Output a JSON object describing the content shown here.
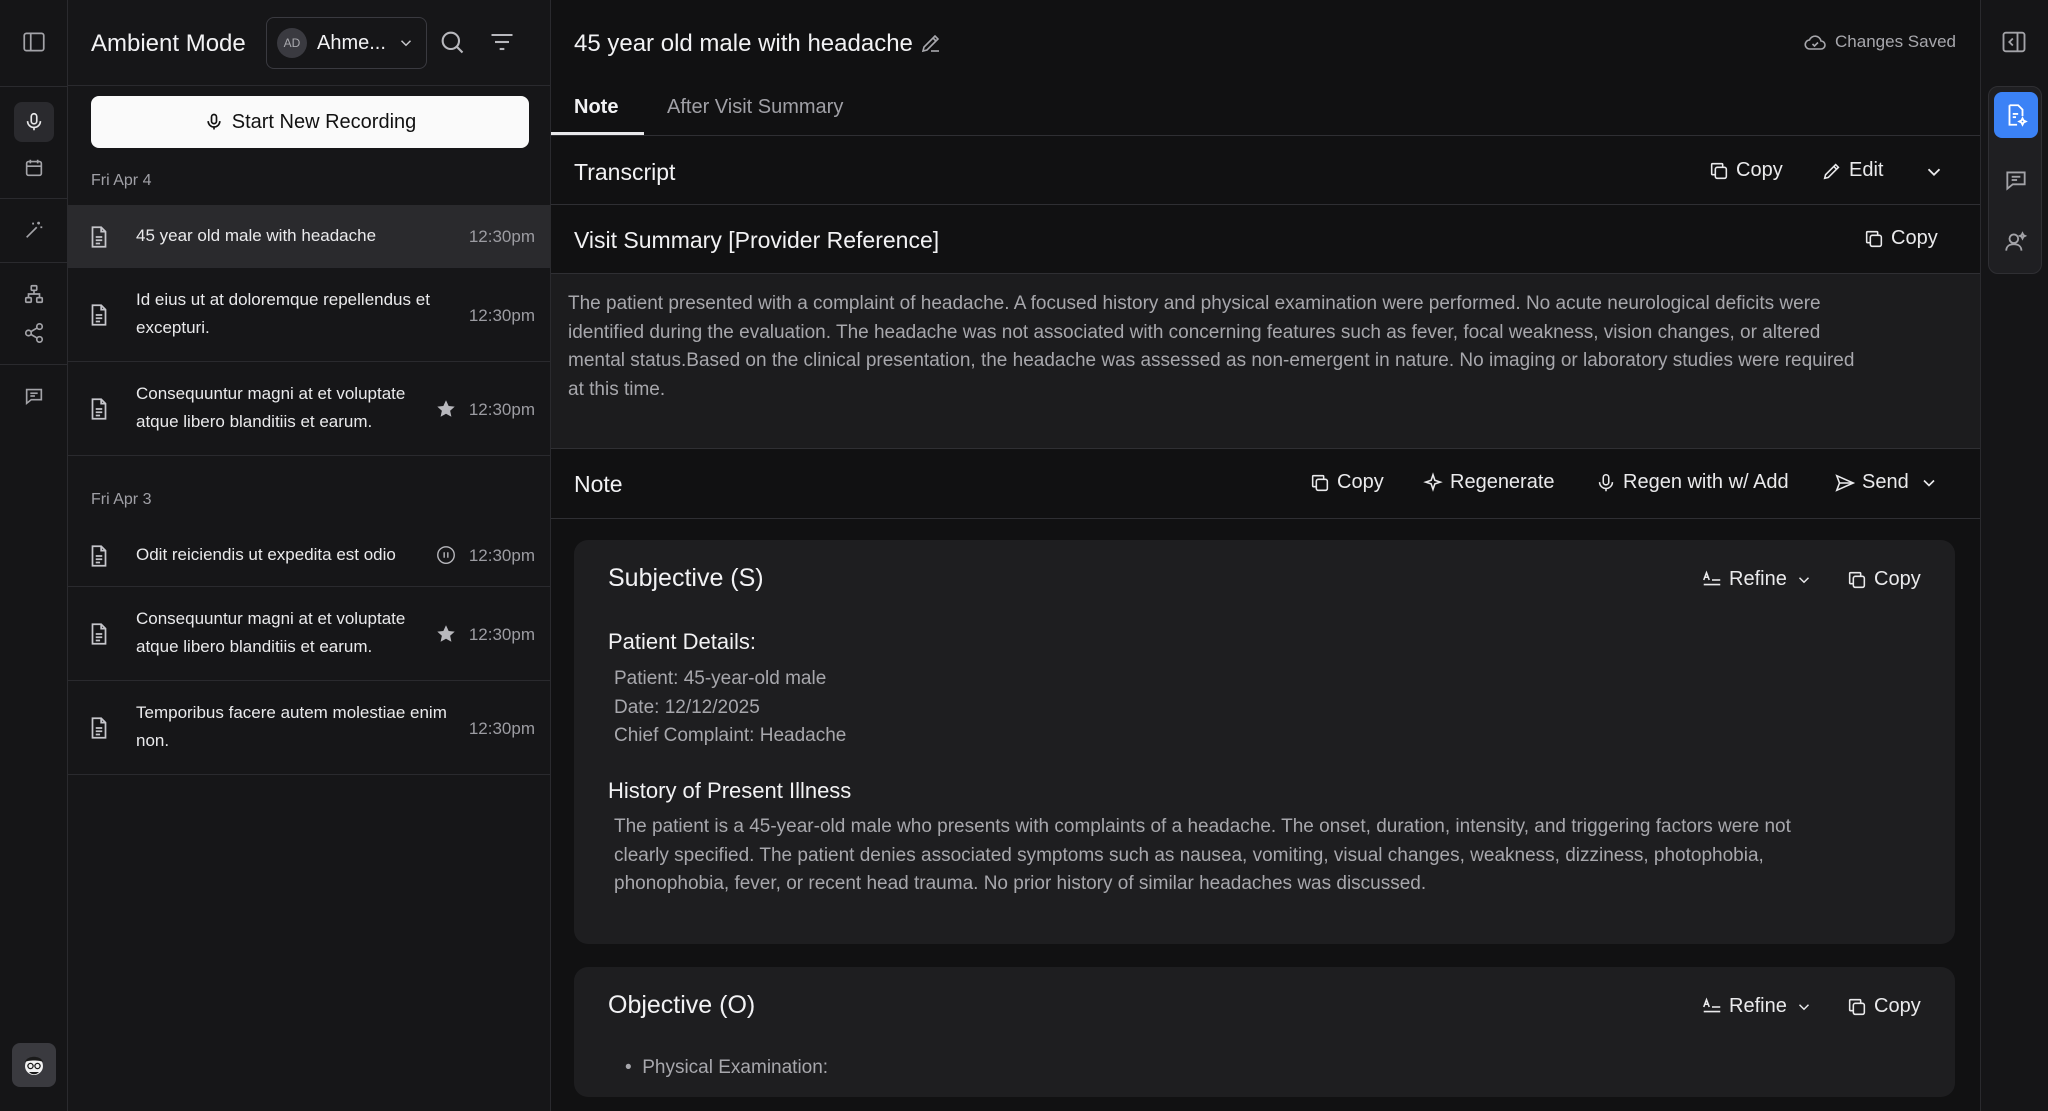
{
  "sidebar_list": {
    "title": "Ambient Mode",
    "user_initials": "AD",
    "user_name": "Ahme...",
    "start_recording_label": "Start New Recording",
    "groups": [
      {
        "date": "Fri Apr 4",
        "items": [
          {
            "title": "45 year old male with headache",
            "time": "12:30pm"
          },
          {
            "title": "Id eius ut at doloremque repellendus et excepturi.",
            "time": "12:30pm"
          },
          {
            "title": "Consequuntur magni at et voluptate atque libero blanditiis et earum.",
            "time": "12:30pm",
            "marker": "star-icon"
          }
        ]
      },
      {
        "date": "Fri Apr 3",
        "items": [
          {
            "title": "Odit reiciendis ut expedita est odio",
            "time": "12:30pm",
            "marker": "pause-icon"
          },
          {
            "title": "Consequuntur magni at et voluptate atque libero blanditiis et earum.",
            "time": "12:30pm",
            "marker": "star-icon"
          },
          {
            "title": "Temporibus facere autem molestiae enim non.",
            "time": "12:30pm"
          }
        ]
      }
    ]
  },
  "main": {
    "title": "45 year old male with headache",
    "save_status": "Changes Saved",
    "tabs": [
      "Note",
      "After Visit Summary"
    ],
    "transcript": {
      "label": "Transcript",
      "copy": "Copy",
      "edit": "Edit"
    },
    "visit_summary": {
      "label": "Visit Summary [Provider Reference]",
      "copy": "Copy",
      "lines": [
        "The patient presented with a complaint of headache. A focused history and physical examination were performed. No acute neurological deficits were",
        "identified during the evaluation. The headache was not associated with concerning features such as fever, focal weakness, vision changes, or altered",
        "mental status.Based on the clinical presentation, the headache was assessed as non-emergent in nature. No imaging or laboratory studies were required",
        "at this time."
      ]
    },
    "note_bar": {
      "label": "Note",
      "copy": "Copy",
      "regenerate": "Regenerate",
      "regen_add": "Regen with w/ Add",
      "send": "Send"
    },
    "subjective": {
      "title": "Subjective (S)",
      "refine": "Refine",
      "copy": "Copy",
      "details_heading": "Patient Details:",
      "details": [
        "Patient: 45-year-old male",
        "Date: 12/12/2025",
        "Chief Complaint: Headache"
      ],
      "hpi_heading": "History of Present Illness",
      "hpi_lines": [
        "The patient is a 45-year-old male who presents with complaints of a headache. The onset, duration, intensity, and triggering factors were not",
        "clearly specified. The patient denies associated symptoms such as nausea, vomiting, visual changes, weakness, dizziness, photophobia,",
        "phonophobia, fever, or recent head trauma. No prior history of similar headaches was discussed."
      ]
    },
    "objective": {
      "title": "Objective (O)",
      "refine": "Refine",
      "copy": "Copy",
      "bullet": "Physical Examination:"
    }
  },
  "colors": {
    "accent": "#3b82f6",
    "background": "#111112",
    "card": "#1e1e20"
  }
}
